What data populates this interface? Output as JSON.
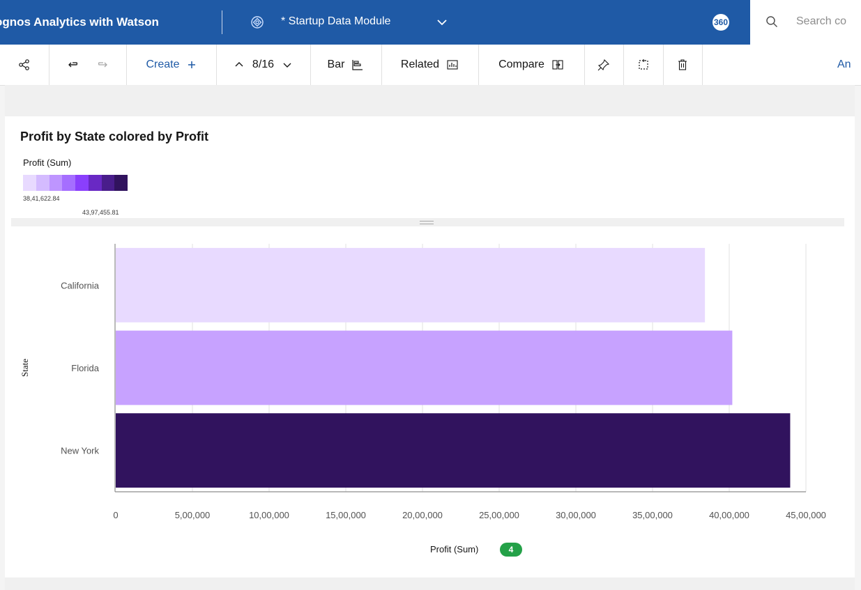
{
  "header": {
    "app_title": "ognos Analytics with Watson",
    "module_name": "* Startup Data Module",
    "notifications_badge": "360",
    "search_placeholder": "Search co"
  },
  "toolbar": {
    "create_label": "Create",
    "page_position": "8/16",
    "bar_label": "Bar",
    "related_label": "Related",
    "compare_label": "Compare",
    "right_label": "An"
  },
  "legend": {
    "title": "Profit (Sum)",
    "min_label": "38,41,622.84",
    "max_label": "43,97,455.81",
    "colors": [
      "#e8daff",
      "#d4bbff",
      "#be95ff",
      "#a56eff",
      "#8a3ffc",
      "#6929c4",
      "#491d8b",
      "#31135e"
    ]
  },
  "chart_data": {
    "type": "bar",
    "orientation": "horizontal",
    "title": "Profit by State colored by Profit",
    "xlabel": "Profit (Sum)",
    "ylabel": "State",
    "categories": [
      "California",
      "Florida",
      "New York"
    ],
    "values": [
      3841622.84,
      4020000,
      4397455.81
    ],
    "colors": [
      "#e8daff",
      "#c7a2ff",
      "#31135e"
    ],
    "xlim": [
      0,
      4500000
    ],
    "xticks": [
      0,
      500000,
      1000000,
      1500000,
      2000000,
      2500000,
      3000000,
      3500000,
      4000000,
      4500000
    ],
    "xtick_labels": [
      "0",
      "5,00,000",
      "10,00,000",
      "15,00,000",
      "20,00,000",
      "25,00,000",
      "30,00,000",
      "35,00,000",
      "40,00,000",
      "45,00,000"
    ],
    "grid": true,
    "count_badge": "4"
  }
}
